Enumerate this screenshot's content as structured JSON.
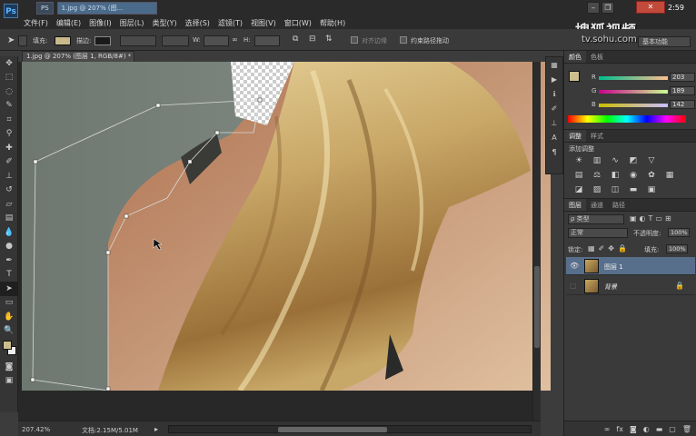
{
  "app": {
    "logo": "Ps",
    "menus": [
      "文件(F)",
      "编辑(E)",
      "图像(I)",
      "图层(L)",
      "类型(Y)",
      "选择(S)",
      "滤镜(T)",
      "视图(V)",
      "窗口(W)",
      "帮助(H)"
    ],
    "taskbar_tabs": [
      "PS",
      "1.jpg @ 207% (图..."
    ],
    "clock": "2:59",
    "watermark_brand": "搜狐视频",
    "watermark_url": "tv.sohu.com"
  },
  "options": {
    "fill_label": "填充:",
    "stroke_label": "描边:",
    "w_label": "W:",
    "h_label": "H:",
    "align_edges": "对齐边缘",
    "constrain_path": "约束路径拖动",
    "workspace": "基本功能",
    "fill_color": "#c9b98a"
  },
  "document": {
    "tab_title": "1.jpg @ 207% (图层 1, RGB/8#) *",
    "zoom": "207.42%",
    "doc_size": "文档:2.15M/5.01M"
  },
  "color_panel": {
    "tabs": [
      "颜色",
      "色板"
    ],
    "r": {
      "label": "R",
      "value": "203"
    },
    "g": {
      "label": "G",
      "value": "189"
    },
    "b": {
      "label": "B",
      "value": "142"
    },
    "foreground": "#cbbd8e"
  },
  "adjustments": {
    "tabs": [
      "调整",
      "样式"
    ],
    "title": "添加调整"
  },
  "layers": {
    "tabs": [
      "图层",
      "通道",
      "路径"
    ],
    "filter": "ρ 类型",
    "blend_mode": "正常",
    "opacity_label": "不透明度:",
    "opacity_value": "100%",
    "lock_label": "锁定:",
    "fill_label": "填充:",
    "fill_value": "100%",
    "items": [
      {
        "name": "图层 1",
        "selected": true
      },
      {
        "name": "背景",
        "selected": false
      }
    ]
  }
}
